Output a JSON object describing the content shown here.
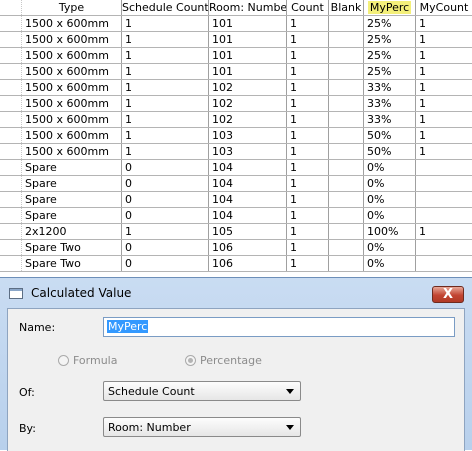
{
  "table": {
    "headers": [
      "Type",
      "Schedule Count",
      "Room: Number",
      "Count",
      "Blank",
      "MyPerc",
      "MyCount"
    ],
    "rows": [
      [
        "1500 x 600mm",
        "1",
        "101",
        "1",
        "",
        "25%",
        "1"
      ],
      [
        "1500 x 600mm",
        "1",
        "101",
        "1",
        "",
        "25%",
        "1"
      ],
      [
        "1500 x 600mm",
        "1",
        "101",
        "1",
        "",
        "25%",
        "1"
      ],
      [
        "1500 x 600mm",
        "1",
        "101",
        "1",
        "",
        "25%",
        "1"
      ],
      [
        "1500 x 600mm",
        "1",
        "102",
        "1",
        "",
        "33%",
        "1"
      ],
      [
        "1500 x 600mm",
        "1",
        "102",
        "1",
        "",
        "33%",
        "1"
      ],
      [
        "1500 x 600mm",
        "1",
        "102",
        "1",
        "",
        "33%",
        "1"
      ],
      [
        "1500 x 600mm",
        "1",
        "103",
        "1",
        "",
        "50%",
        "1"
      ],
      [
        "1500 x 600mm",
        "1",
        "103",
        "1",
        "",
        "50%",
        "1"
      ],
      [
        "Spare",
        "0",
        "104",
        "1",
        "",
        "0%",
        ""
      ],
      [
        "Spare",
        "0",
        "104",
        "1",
        "",
        "0%",
        ""
      ],
      [
        "Spare",
        "0",
        "104",
        "1",
        "",
        "0%",
        ""
      ],
      [
        "Spare",
        "0",
        "104",
        "1",
        "",
        "0%",
        ""
      ],
      [
        "2x1200",
        "1",
        "105",
        "1",
        "",
        "100%",
        "1"
      ],
      [
        "Spare Two",
        "0",
        "106",
        "1",
        "",
        "0%",
        ""
      ],
      [
        "Spare Two",
        "0",
        "106",
        "1",
        "",
        "0%",
        ""
      ]
    ]
  },
  "dialog": {
    "title": "Calculated Value",
    "close_label": "X",
    "name_label": "Name:",
    "name_value": "MyPerc",
    "formula_label": "Formula",
    "percentage_label": "Percentage",
    "of_label": "Of:",
    "of_value": "Schedule Count",
    "by_label": "By:",
    "by_value": "Room: Number"
  },
  "colors": {
    "highlight": "#f4f07a",
    "title_bar": "#c9dcf2",
    "close_button": "#c24532",
    "selection": "#3399ff"
  }
}
